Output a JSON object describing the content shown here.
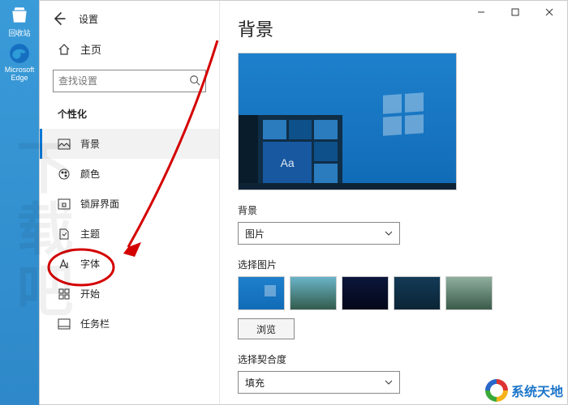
{
  "desktop": {
    "recycle_bin": "回收站",
    "edge": "Microsoft Edge"
  },
  "window": {
    "title_app": "设置",
    "home_label": "主页",
    "search_placeholder": "查找设置",
    "section_label": "个性化"
  },
  "sidebar": {
    "items": [
      {
        "label": "背景"
      },
      {
        "label": "颜色"
      },
      {
        "label": "锁屏界面"
      },
      {
        "label": "主题"
      },
      {
        "label": "字体"
      },
      {
        "label": "开始"
      },
      {
        "label": "任务栏"
      }
    ]
  },
  "main": {
    "page_title": "背景",
    "preview_text": "Aa",
    "bg_label": "背景",
    "bg_combo_value": "图片",
    "choose_pic_label": "选择图片",
    "browse_label": "浏览",
    "fit_label": "选择契合度",
    "fit_combo_value": "填充"
  },
  "watermark": {
    "text": "下载吧",
    "brand": "系统天地"
  }
}
